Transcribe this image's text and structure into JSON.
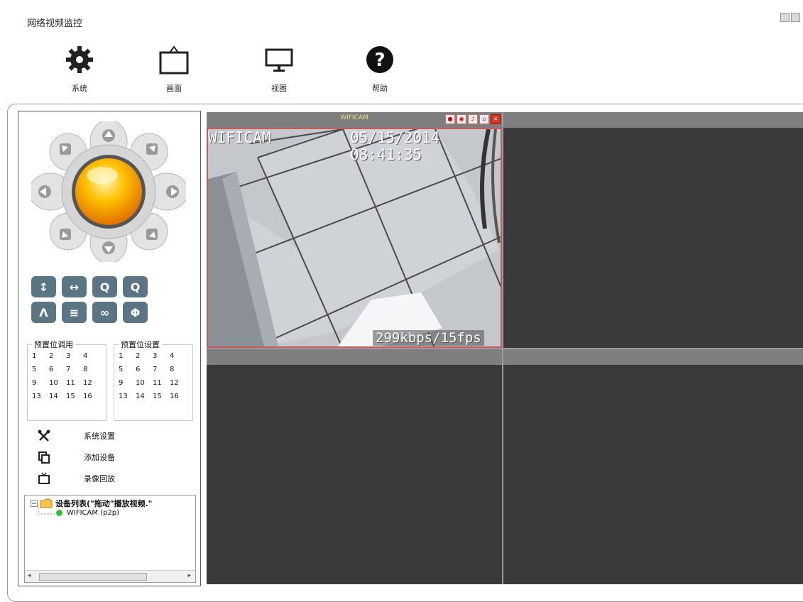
{
  "window": {
    "title": "网络视频监控"
  },
  "toolbar": [
    {
      "label": "系统",
      "icon": "gear-icon"
    },
    {
      "label": "画面",
      "icon": "screen-layout-icon"
    },
    {
      "label": "视图",
      "icon": "monitor-icon"
    },
    {
      "label": "帮助",
      "icon": "help-icon"
    }
  ],
  "ptz_controls": [
    {
      "symbol": "↕",
      "icon": "flip-vertical-icon"
    },
    {
      "symbol": "↔",
      "icon": "flip-horizontal-icon"
    },
    {
      "symbol": "Q",
      "icon": "zoom-out-icon"
    },
    {
      "symbol": "Q",
      "icon": "zoom-in-icon"
    },
    {
      "symbol": "Λ",
      "icon": "cruise-vertical-icon"
    },
    {
      "symbol": "≡",
      "icon": "cruise-horizontal-icon"
    },
    {
      "symbol": "∞",
      "icon": "cruise-all-icon"
    },
    {
      "symbol": "Φ",
      "icon": "focus-icon"
    }
  ],
  "presets": {
    "call_title": "预置位调用",
    "set_title": "预置位设置",
    "numbers": [
      "1",
      "2",
      "3",
      "4",
      "5",
      "6",
      "7",
      "8",
      "9",
      "10",
      "11",
      "12",
      "13",
      "14",
      "15",
      "16"
    ]
  },
  "menu": [
    {
      "label": "系统设置",
      "icon": "tools-icon"
    },
    {
      "label": "添加设备",
      "icon": "add-device-icon"
    },
    {
      "label": "录像回放",
      "icon": "playback-icon"
    }
  ],
  "device_tree": {
    "root_label": "设备列表(\"拖动\"播放视频.\"",
    "devices": [
      {
        "label": "WIFICAM (p2p)",
        "status_color": "#2fc12f"
      }
    ]
  },
  "video": {
    "camera_name": "WIFICAM",
    "osd_name": "WIFICAM",
    "osd_datetime": "05/15/2014 08:41:35",
    "osd_rate": "299kbps/15fps"
  },
  "colors": {
    "ptz_center": "#f2a000",
    "control_button": "#5b7584",
    "active_border": "#c85a5a"
  }
}
